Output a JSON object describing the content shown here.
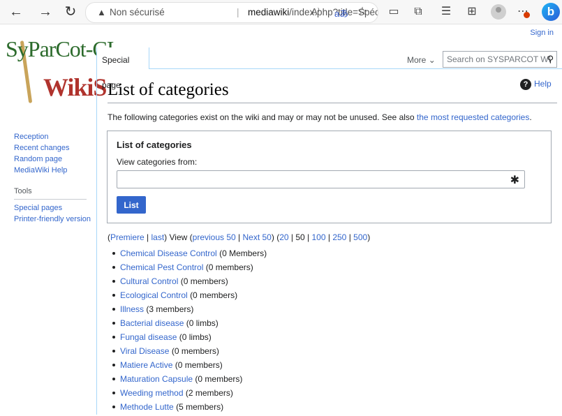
{
  "browser": {
    "security": "Non sécurisé",
    "url_host": "mediawiki",
    "url_path": "/index.php?title=Spécial:C...",
    "read_aloud": "A⁾",
    "translate": "aあ"
  },
  "user": {
    "sign_in": "Sign in"
  },
  "logo": {
    "line1": "SyParCot-CI",
    "line2": "WikiS"
  },
  "sidebar": {
    "nav": [
      "Reception",
      "Recent changes",
      "Random page",
      "MediaWiki Help"
    ],
    "tools_heading": "Tools",
    "tools": [
      "Special pages",
      "Printer-friendly version"
    ]
  },
  "tabs": {
    "special": "Special page",
    "more": "More"
  },
  "search": {
    "placeholder": "Search on SYSPARCOT WI"
  },
  "page": {
    "title": "List of categories",
    "help": "Help",
    "intro_text": "The following categories exist on the wiki and may or may not be unused. See also ",
    "intro_link": "the most requested categories",
    "intro_end": "."
  },
  "form": {
    "legend": "List of categories",
    "label": "View categories from:",
    "value": "",
    "submit": "List"
  },
  "pager": {
    "first": "Premiere",
    "last": "last",
    "view": "View",
    "prev": "previous 50",
    "next": "Next 50",
    "limits": [
      "20",
      "50",
      "100",
      "250",
      "500"
    ],
    "current_limit": "50"
  },
  "categories": [
    {
      "name": "Chemical Disease Control",
      "count": "(0 Members)"
    },
    {
      "name": "Chemical Pest Control",
      "count": "(0 members)"
    },
    {
      "name": "Cultural Control",
      "count": "(0 members)"
    },
    {
      "name": "Ecological Control",
      "count": "(0 members)"
    },
    {
      "name": "Illness",
      "count": "(3 members)"
    },
    {
      "name": "Bacterial disease",
      "count": "(0 limbs)"
    },
    {
      "name": "Fungal disease",
      "count": "(0 limbs)"
    },
    {
      "name": "Viral Disease",
      "count": "(0 members)"
    },
    {
      "name": "Matiere Active",
      "count": "(0 members)"
    },
    {
      "name": "Maturation Capsule",
      "count": "(0 members)"
    },
    {
      "name": "Weeding method",
      "count": "(2 members)"
    },
    {
      "name": "Methode Lutte",
      "count": "(5 members)"
    }
  ],
  "colors": {
    "link": "#3366cc",
    "button": "#3366cc",
    "tab_border": "#a7d7f9"
  }
}
